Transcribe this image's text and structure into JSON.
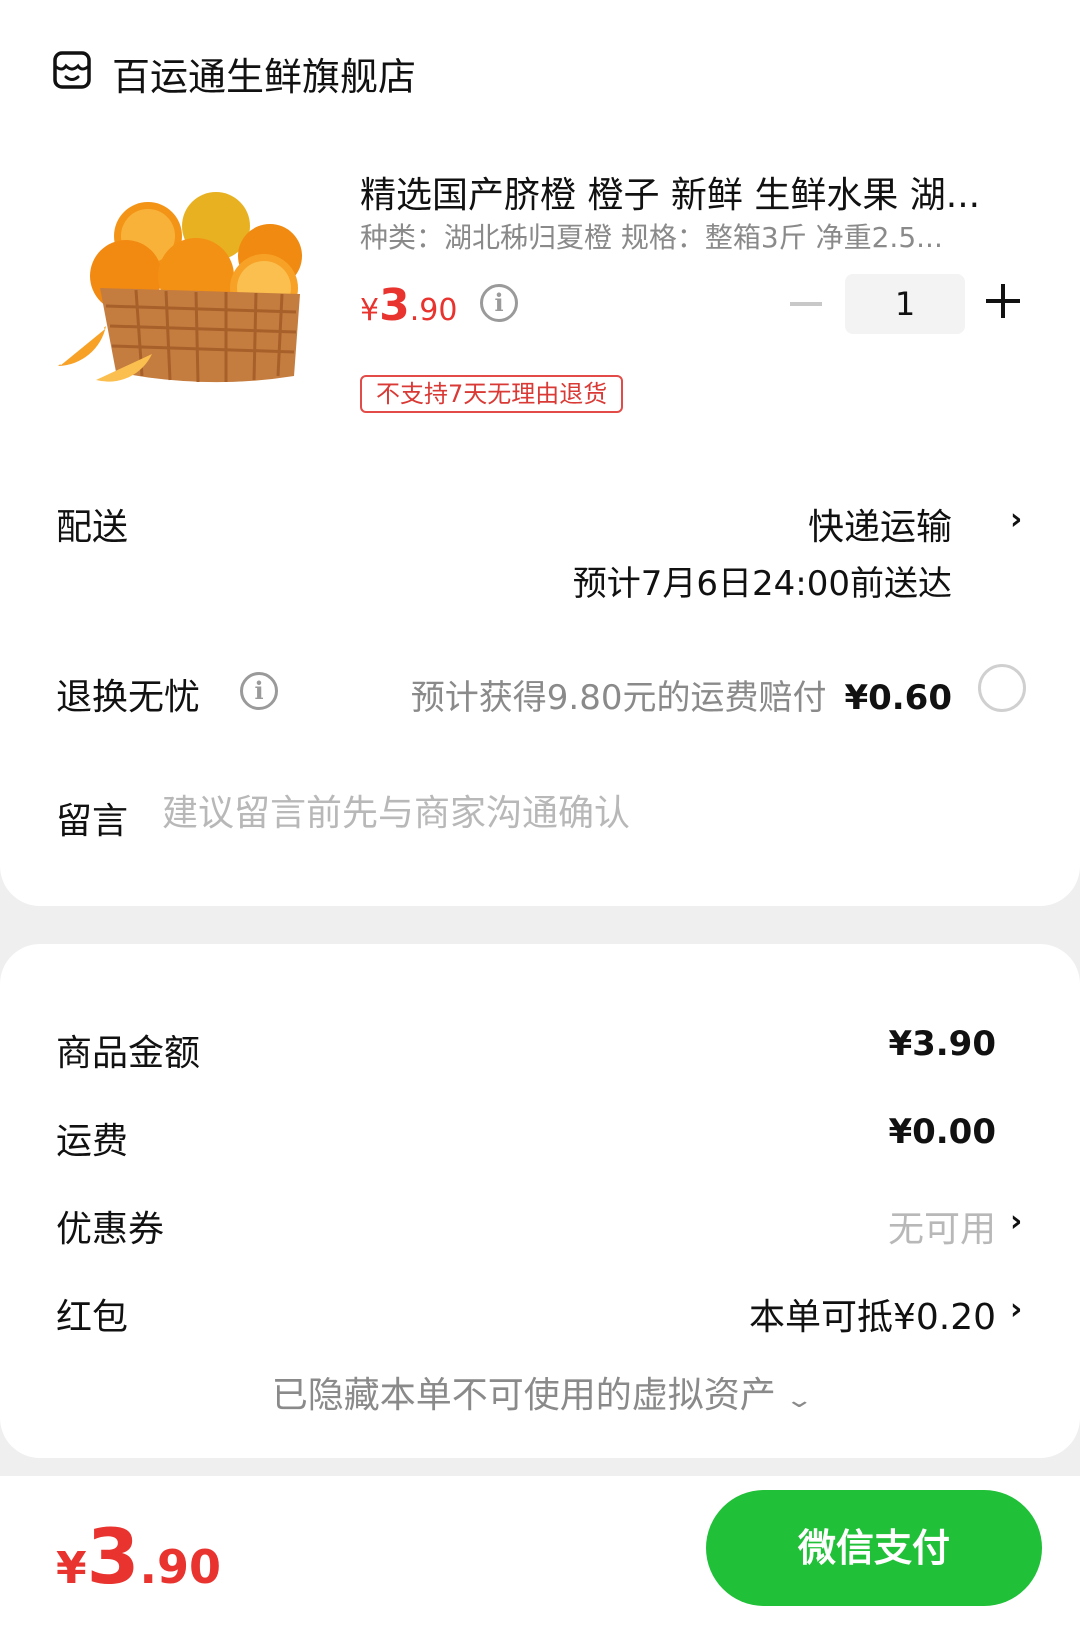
{
  "shop": {
    "name": "百运通生鲜旗舰店",
    "icon": "shop-icon"
  },
  "product": {
    "title": "精选国产脐橙 橙子  新鲜 生鲜水果 湖...",
    "specs": "种类：湖北秭归夏橙   规格：整箱3斤 净重2.5...",
    "price": {
      "symbol": "¥",
      "integer": "3",
      "decimal": ".90"
    },
    "quantity": "1",
    "return_tag": "不支持7天无理由退货",
    "image": "orange-basket"
  },
  "delivery": {
    "label": "配送",
    "method": "快递运输",
    "eta": "预计7月6日24:00前送达"
  },
  "return_insurance": {
    "label": "退换无忧",
    "desc": "预计获得9.80元的运费赔付",
    "amount": "¥0.60"
  },
  "message": {
    "label": "留言",
    "placeholder": "建议留言前先与商家沟通确认"
  },
  "summary": {
    "goods_label": "商品金额",
    "goods_value": "¥3.90",
    "shipping_label": "运费",
    "shipping_value": "¥0.00",
    "coupon_label": "优惠券",
    "coupon_value": "无可用",
    "redpack_label": "红包",
    "redpack_value": "本单可抵¥0.20",
    "hidden_assets": "已隐藏本单不可使用的虚拟资产"
  },
  "footer": {
    "total": {
      "symbol": "¥",
      "integer": "3",
      "decimal": ".90"
    },
    "pay_button": "微信支付"
  },
  "colors": {
    "price_red": "#e8332e",
    "pay_green": "#20c038"
  }
}
